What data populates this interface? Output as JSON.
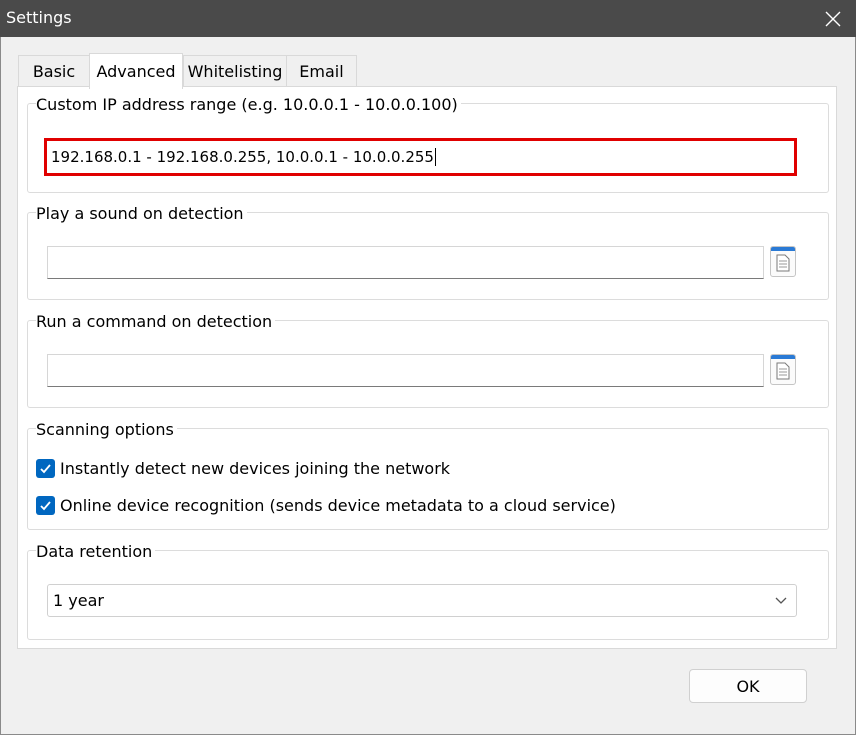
{
  "window": {
    "title": "Settings"
  },
  "tabs": [
    {
      "label": "Basic"
    },
    {
      "label": "Advanced"
    },
    {
      "label": "Whitelisting"
    },
    {
      "label": "Email"
    }
  ],
  "active_tab": "Advanced",
  "ip_range": {
    "title": "Custom IP address range (e.g. 10.0.0.1 - 10.0.0.100)",
    "value": "192.168.0.1 - 192.168.0.255, 10.0.0.1 - 10.0.0.255"
  },
  "sound": {
    "title": "Play a sound on detection",
    "value": "",
    "browse_icon": "file-browse-icon"
  },
  "command": {
    "title": "Run a command on detection",
    "value": "",
    "browse_icon": "file-browse-icon"
  },
  "scanning": {
    "title": "Scanning options",
    "options": [
      {
        "label": "Instantly detect new devices joining the network",
        "checked": true
      },
      {
        "label": "Online device recognition (sends device metadata to a cloud service)",
        "checked": true
      }
    ]
  },
  "retention": {
    "title": "Data retention",
    "selected": "1 year"
  },
  "buttons": {
    "ok": "OK"
  },
  "colors": {
    "accent": "#0067c0",
    "highlight_border": "#e00000",
    "titlebar": "#4a4a4a"
  }
}
